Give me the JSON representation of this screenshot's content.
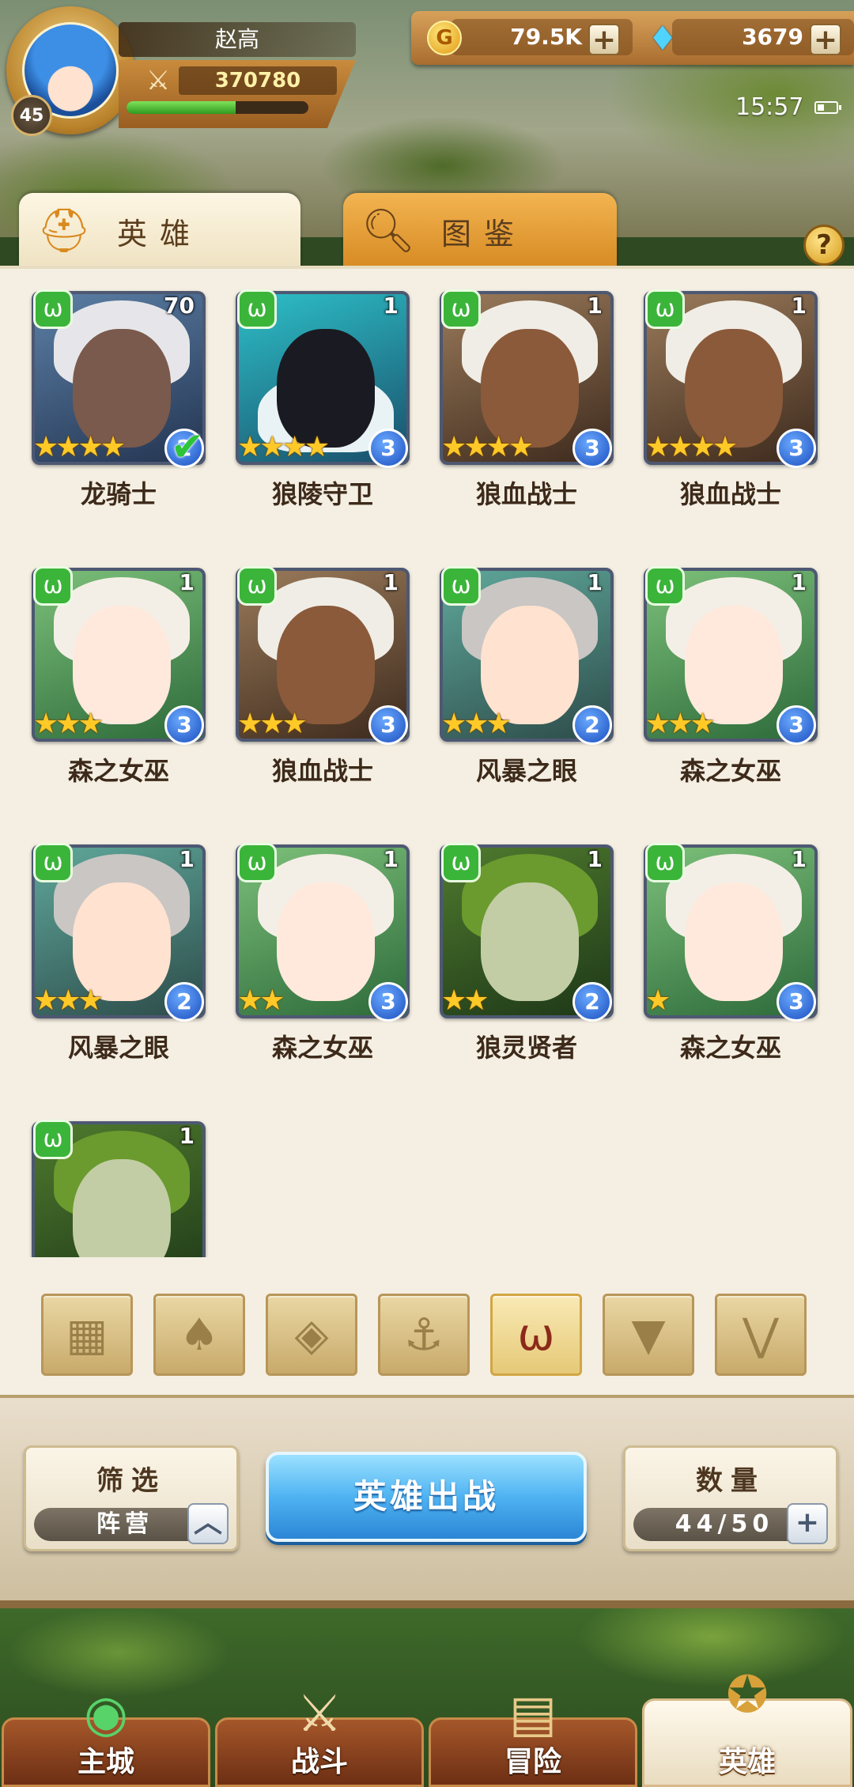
{
  "player": {
    "name": "赵高",
    "level": "45",
    "power": "370780",
    "exp_fraction": 0.6
  },
  "currency": {
    "gold": "79.5K",
    "gems": "3679"
  },
  "status": {
    "time": "15:57"
  },
  "tabs": [
    {
      "label": "英雄",
      "icon": "helmet-icon",
      "active": true
    },
    {
      "label": "图鉴",
      "icon": "magnifier-icon",
      "active": false
    }
  ],
  "heroes": [
    {
      "name": "龙骑士",
      "level": "70",
      "stars": 4,
      "rank": "2",
      "selected": true,
      "portrait": "dragon"
    },
    {
      "name": "狼陵守卫",
      "level": "1",
      "stars": 4,
      "rank": "3",
      "selected": false,
      "portrait": "anubis"
    },
    {
      "name": "狼血战士",
      "level": "1",
      "stars": 4,
      "rank": "3",
      "selected": false,
      "portrait": "wolf"
    },
    {
      "name": "狼血战士",
      "level": "1",
      "stars": 4,
      "rank": "3",
      "selected": false,
      "portrait": "wolf"
    },
    {
      "name": "森之女巫",
      "level": "1",
      "stars": 3,
      "rank": "3",
      "selected": false,
      "portrait": "elf"
    },
    {
      "name": "狼血战士",
      "level": "1",
      "stars": 3,
      "rank": "3",
      "selected": false,
      "portrait": "wolf"
    },
    {
      "name": "风暴之眼",
      "level": "1",
      "stars": 3,
      "rank": "2",
      "selected": false,
      "portrait": "storm"
    },
    {
      "name": "森之女巫",
      "level": "1",
      "stars": 3,
      "rank": "3",
      "selected": false,
      "portrait": "elf"
    },
    {
      "name": "风暴之眼",
      "level": "1",
      "stars": 3,
      "rank": "2",
      "selected": false,
      "portrait": "storm"
    },
    {
      "name": "森之女巫",
      "level": "1",
      "stars": 2,
      "rank": "3",
      "selected": false,
      "portrait": "elf"
    },
    {
      "name": "狼灵贤者",
      "level": "1",
      "stars": 2,
      "rank": "2",
      "selected": false,
      "portrait": "sage"
    },
    {
      "name": "森之女巫",
      "level": "1",
      "stars": 1,
      "rank": "3",
      "selected": false,
      "portrait": "elf"
    },
    {
      "name": "",
      "level": "1",
      "stars": 0,
      "rank": "",
      "selected": false,
      "portrait": "sage"
    }
  ],
  "filters": [
    {
      "icon": "grid-all-icon",
      "active": false
    },
    {
      "icon": "lotus-faction-icon",
      "active": false
    },
    {
      "icon": "diamond-faction-icon",
      "active": false
    },
    {
      "icon": "anchor-faction-icon",
      "active": false
    },
    {
      "icon": "wolf-faction-icon",
      "active": true
    },
    {
      "icon": "horned-faction-icon",
      "active": false
    },
    {
      "icon": "wings-faction-icon",
      "active": false
    }
  ],
  "filter_box": {
    "title": "筛选",
    "value": "阵营"
  },
  "deploy_button": "英雄出战",
  "count_box": {
    "title": "数量",
    "value": "44/50"
  },
  "nav": [
    {
      "label": "主城",
      "icon": "castle-icon",
      "active": false
    },
    {
      "label": "战斗",
      "icon": "crossed-swords-icon",
      "active": false
    },
    {
      "label": "冒险",
      "icon": "scroll-map-icon",
      "active": false
    },
    {
      "label": "英雄",
      "icon": "hero-crest-icon",
      "active": true
    }
  ],
  "colors": {
    "faction_green": "#3bb43a",
    "rank_blue": "#1b4fbf",
    "star_gold": "#ffc928",
    "deploy_blue": "#4fb3f2"
  }
}
